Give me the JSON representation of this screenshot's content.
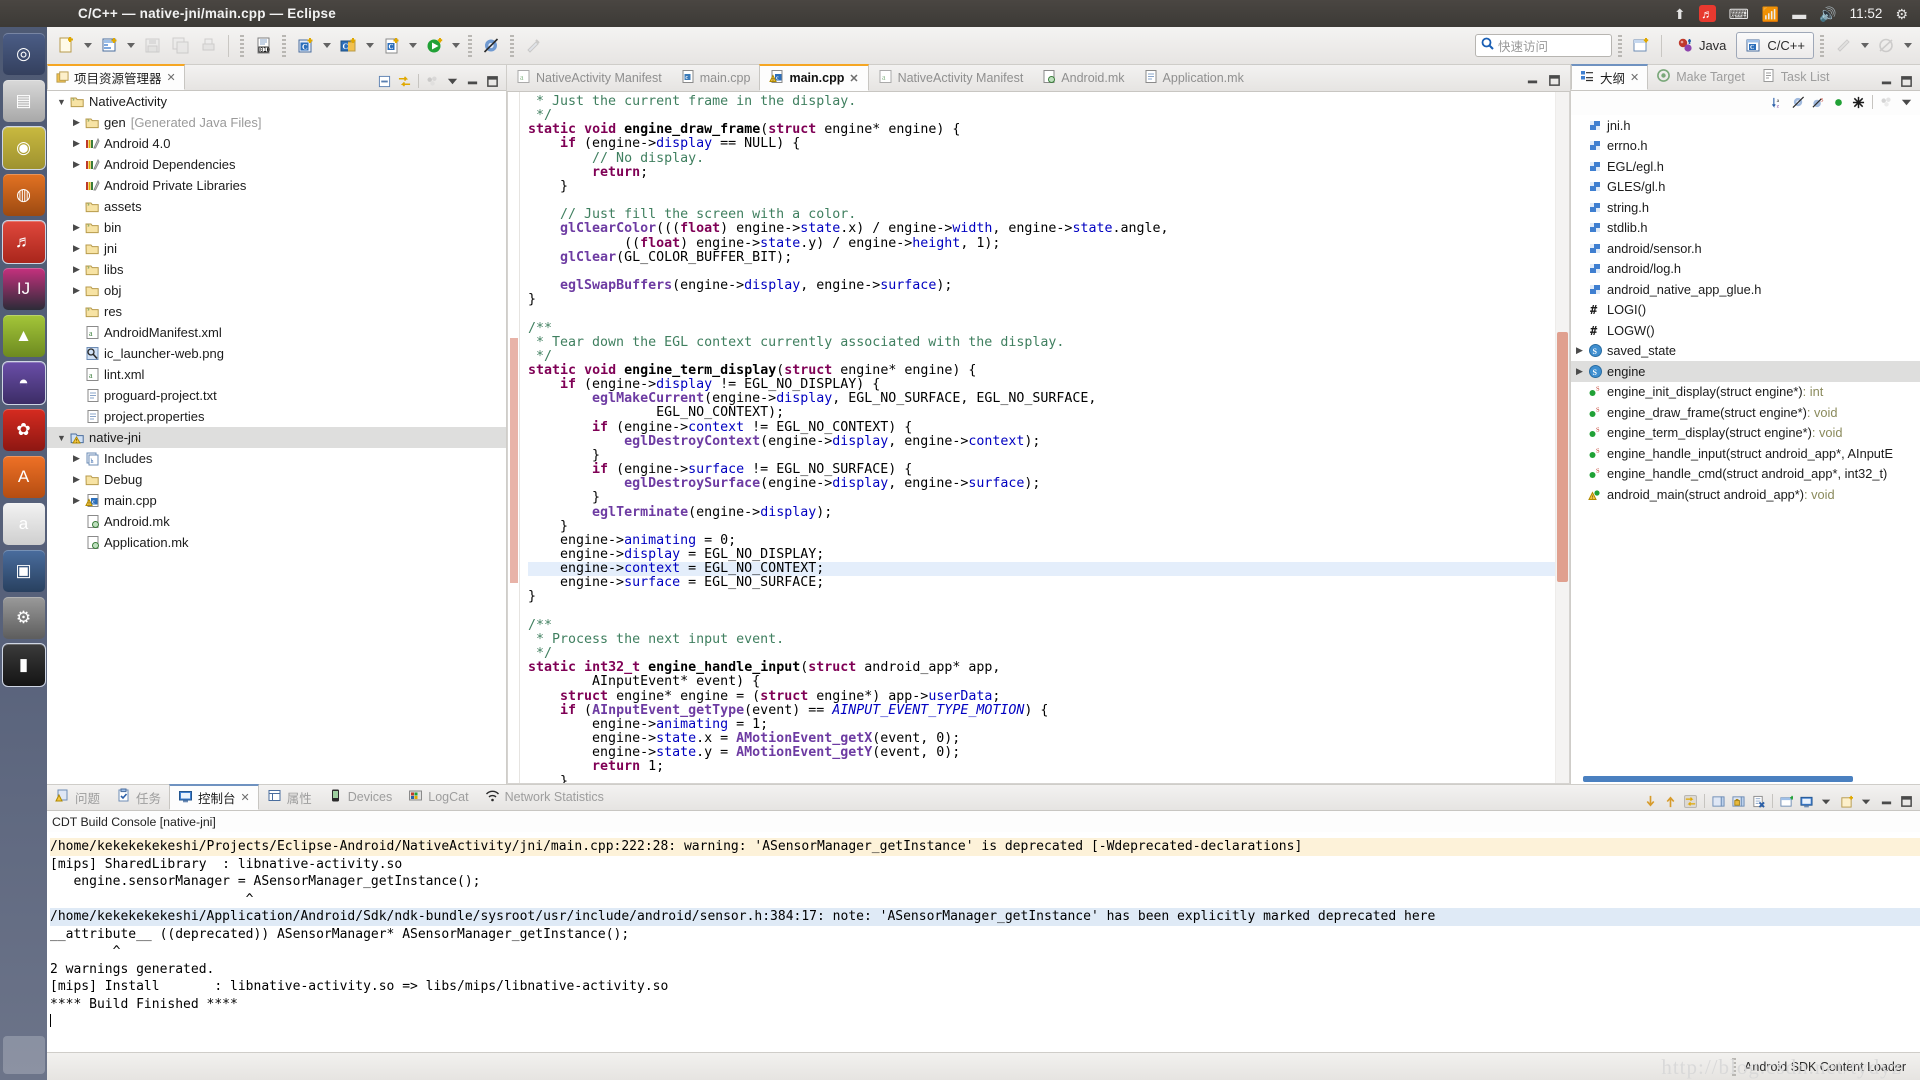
{
  "window": {
    "title": "C/C++ — native-jni/main.cpp — Eclipse"
  },
  "tray": {
    "indicator_icon": "upload-indicator-icon",
    "music_icon": "netease-music-icon",
    "keyboard_icon": "keyboard-layout-icon",
    "wifi_icon": "wifi-icon",
    "battery_icon": "battery-icon",
    "volume_icon": "volume-icon",
    "clock": "11:52",
    "session_icon": "system-settings-icon"
  },
  "launcher": {
    "items": [
      {
        "name": "ubuntu-dash-icon",
        "glyph": "◎",
        "color1": "#4b5d86",
        "color2": "#34405e",
        "selected": false
      },
      {
        "name": "files-icon",
        "glyph": "▤",
        "color1": "#d9d9d9",
        "color2": "#a8a8a8",
        "selected": false
      },
      {
        "name": "chrome-icon",
        "glyph": "◉",
        "color1": "#c9b93f",
        "color2": "#9e9230",
        "selected": true
      },
      {
        "name": "firefox-icon",
        "glyph": "◍",
        "color1": "#e37222",
        "color2": "#9c4a12",
        "selected": false
      },
      {
        "name": "netease-music-icon",
        "glyph": "♬",
        "color1": "#e0483c",
        "color2": "#a9261c",
        "selected": true
      },
      {
        "name": "intellij-idea-icon",
        "glyph": "IJ",
        "color1": "#c6307e",
        "color2": "#2c2c38",
        "selected": false
      },
      {
        "name": "android-studio-icon",
        "glyph": "▲",
        "color1": "#a4c639",
        "color2": "#6d8a20",
        "selected": false
      },
      {
        "name": "eclipse-icon",
        "glyph": "◓",
        "color1": "#6a4ea8",
        "color2": "#3c2d66",
        "selected": true
      },
      {
        "name": "redis-icon",
        "glyph": "✿",
        "color1": "#d62b20",
        "color2": "#8d1712",
        "selected": false
      },
      {
        "name": "software-center-icon",
        "glyph": "A",
        "color1": "#ef7126",
        "color2": "#b44d12",
        "selected": false
      },
      {
        "name": "amazon-icon",
        "glyph": "a",
        "color1": "#f2f2f2",
        "color2": "#cfcfcf",
        "selected": false
      },
      {
        "name": "virtualbox-icon",
        "glyph": "▣",
        "color1": "#4a6d9e",
        "color2": "#28405f",
        "selected": false
      },
      {
        "name": "system-settings-icon",
        "glyph": "⚙",
        "color1": "#9a9a9a",
        "color2": "#5d5d5d",
        "selected": false
      },
      {
        "name": "terminal-icon",
        "glyph": "▮",
        "color1": "#3b3b3b",
        "color2": "#141414",
        "selected": true
      }
    ],
    "trash_name": "trash-icon"
  },
  "toolbar": {
    "buttons": [
      {
        "name": "new-file-button",
        "caret": true
      },
      {
        "name": "new-wizard-button",
        "caret": true
      },
      {
        "name": "save-button",
        "caret": false,
        "disabled": true
      },
      {
        "name": "save-all-button",
        "caret": false,
        "disabled": true
      },
      {
        "name": "print-button",
        "caret": false,
        "disabled": true
      },
      {
        "name": "binary-file-button",
        "caret": false
      },
      {
        "name": "build-all-button",
        "caret": true
      },
      {
        "name": "open-element-button",
        "caret": true
      },
      {
        "name": "new-c-class-button",
        "caret": true
      },
      {
        "name": "run-button",
        "caret": true
      },
      {
        "name": "skip-breakpoints-button",
        "caret": false
      },
      {
        "name": "external-tools-button",
        "caret": false,
        "disabled": true
      },
      {
        "name": "search-button",
        "caret": false,
        "disabled": true
      },
      {
        "name": "debug-perspective-button",
        "caret": true,
        "disabled": true
      }
    ],
    "quick_access": {
      "icon": "search-icon",
      "placeholder": "快速访问"
    },
    "open_perspective_name": "open-perspective-button",
    "perspectives": [
      {
        "label": "Java",
        "icon": "java-perspective-icon",
        "active": false
      },
      {
        "label": "C/C++",
        "icon": "cpp-perspective-icon",
        "active": true
      }
    ]
  },
  "explorer": {
    "tab": {
      "label": "项目资源管理器",
      "close": "✕",
      "icon": "project-explorer-icon"
    },
    "tools": [
      "collapse-all-icon",
      "link-with-editor-icon",
      "view-menu-icon",
      "minimize-icon",
      "maximize-icon"
    ],
    "tree": [
      {
        "label": "NativeActivity",
        "indent": 0,
        "arrow": "open",
        "icon": "java-project-icon",
        "selected": false
      },
      {
        "label": "gen",
        "suffix": "[Generated Java Files]",
        "indent": 1,
        "arrow": "closed",
        "icon": "source-folder-icon"
      },
      {
        "label": "Android 4.0",
        "indent": 1,
        "arrow": "closed",
        "icon": "library-icon"
      },
      {
        "label": "Android Dependencies",
        "indent": 1,
        "arrow": "closed",
        "icon": "library-icon"
      },
      {
        "label": "Android Private Libraries",
        "indent": 1,
        "arrow": "none",
        "icon": "library-icon"
      },
      {
        "label": "assets",
        "indent": 1,
        "arrow": "none",
        "icon": "folder-src-icon"
      },
      {
        "label": "bin",
        "indent": 1,
        "arrow": "closed",
        "icon": "folder-src-icon"
      },
      {
        "label": "jni",
        "indent": 1,
        "arrow": "closed",
        "icon": "folder-icon"
      },
      {
        "label": "libs",
        "indent": 1,
        "arrow": "closed",
        "icon": "folder-src-icon"
      },
      {
        "label": "obj",
        "indent": 1,
        "arrow": "closed",
        "icon": "folder-icon"
      },
      {
        "label": "res",
        "indent": 1,
        "arrow": "none",
        "icon": "folder-src-icon"
      },
      {
        "label": "AndroidManifest.xml",
        "indent": 1,
        "arrow": "none",
        "icon": "android-xml-icon"
      },
      {
        "label": "ic_launcher-web.png",
        "indent": 1,
        "arrow": "none",
        "icon": "image-file-icon"
      },
      {
        "label": "lint.xml",
        "indent": 1,
        "arrow": "none",
        "icon": "android-xml-icon"
      },
      {
        "label": "proguard-project.txt",
        "indent": 1,
        "arrow": "none",
        "icon": "text-file-icon"
      },
      {
        "label": "project.properties",
        "indent": 1,
        "arrow": "none",
        "icon": "text-file-icon"
      },
      {
        "label": "native-jni",
        "indent": 0,
        "arrow": "open",
        "icon": "cpp-project-warning-icon",
        "selected": true
      },
      {
        "label": "Includes",
        "indent": 1,
        "arrow": "closed",
        "icon": "includes-icon"
      },
      {
        "label": "Debug",
        "indent": 1,
        "arrow": "closed",
        "icon": "folder-icon"
      },
      {
        "label": "main.cpp",
        "indent": 1,
        "arrow": "closed",
        "icon": "cpp-file-warning-icon"
      },
      {
        "label": "Android.mk",
        "indent": 1,
        "arrow": "none",
        "icon": "makefile-icon"
      },
      {
        "label": "Application.mk",
        "indent": 1,
        "arrow": "none",
        "icon": "makefile-icon"
      }
    ]
  },
  "editor": {
    "tabs": [
      {
        "label": "NativeActivity Manifest",
        "icon": "android-manifest-icon",
        "active": false
      },
      {
        "label": "main.cpp",
        "icon": "c-file-icon",
        "active": false
      },
      {
        "label": "main.cpp",
        "icon": "cpp-file-warning-icon",
        "active": true,
        "close": "✕"
      },
      {
        "label": "NativeActivity Manifest",
        "icon": "android-manifest-icon",
        "active": false
      },
      {
        "label": "Android.mk",
        "icon": "makefile-icon",
        "active": false
      },
      {
        "label": "Application.mk",
        "icon": "text-file-icon",
        "active": false
      }
    ],
    "minimize_name": "minimize-editor-icon",
    "maximize_name": "maximize-editor-icon",
    "code_lines": [
      " * Just the current frame in the display.",
      " */",
      "static void engine_draw_frame(struct engine* engine) {",
      "    if (engine->display == NULL) {",
      "        // No display.",
      "        return;",
      "    }",
      "",
      "    // Just fill the screen with a color.",
      "    glClearColor(((float) engine->state.x) / engine->width, engine->state.angle,",
      "            ((float) engine->state.y) / engine->height, 1);",
      "    glClear(GL_COLOR_BUFFER_BIT);",
      "",
      "    eglSwapBuffers(engine->display, engine->surface);",
      "}",
      "",
      "/**",
      " * Tear down the EGL context currently associated with the display.",
      " */",
      "static void engine_term_display(struct engine* engine) {",
      "    if (engine->display != EGL_NO_DISPLAY) {",
      "        eglMakeCurrent(engine->display, EGL_NO_SURFACE, EGL_NO_SURFACE,",
      "                EGL_NO_CONTEXT);",
      "        if (engine->context != EGL_NO_CONTEXT) {",
      "            eglDestroyContext(engine->display, engine->context);",
      "        }",
      "        if (engine->surface != EGL_NO_SURFACE) {",
      "            eglDestroySurface(engine->display, engine->surface);",
      "        }",
      "        eglTerminate(engine->display);",
      "    }",
      "    engine->animating = 0;",
      "    engine->display = EGL_NO_DISPLAY;",
      "    engine->context = EGL_NO_CONTEXT;",
      "    engine->surface = EGL_NO_SURFACE;",
      "}",
      "",
      "/**",
      " * Process the next input event.",
      " */",
      "static int32_t engine_handle_input(struct android_app* app,",
      "        AInputEvent* event) {",
      "    struct engine* engine = (struct engine*) app->userData;",
      "    if (AInputEvent_getType(event) == AINPUT_EVENT_TYPE_MOTION) {",
      "        engine->animating = 1;",
      "        engine->state.x = AMotionEvent_getX(event, 0);",
      "        engine->state.y = AMotionEvent_getY(event, 0);",
      "        return 1;",
      "    }"
    ],
    "highlighted_line_index": 33
  },
  "outline": {
    "tabs": [
      {
        "label": "大纲",
        "icon": "outline-icon",
        "active": true,
        "close": "✕"
      },
      {
        "label": "Make Target",
        "icon": "make-target-icon",
        "active": false
      },
      {
        "label": "Task List",
        "icon": "task-list-icon",
        "active": false
      }
    ],
    "tools": [
      "sort-icon",
      "hide-fields-icon",
      "hide-static-icon",
      "hide-nonpublic-icon",
      "hide-macros-icon",
      "view-menu-icon"
    ],
    "minimize_name": "minimize-outline-icon",
    "maximize_name": "maximize-outline-icon",
    "items": [
      {
        "label": "jni.h",
        "icon": "include-icon",
        "arrow": "none"
      },
      {
        "label": "errno.h",
        "icon": "include-icon",
        "arrow": "none"
      },
      {
        "label": "EGL/egl.h",
        "icon": "include-icon",
        "arrow": "none"
      },
      {
        "label": "GLES/gl.h",
        "icon": "include-icon",
        "arrow": "none"
      },
      {
        "label": "string.h",
        "icon": "include-icon",
        "arrow": "none"
      },
      {
        "label": "stdlib.h",
        "icon": "include-icon",
        "arrow": "none"
      },
      {
        "label": "android/sensor.h",
        "icon": "include-icon",
        "arrow": "none"
      },
      {
        "label": "android/log.h",
        "icon": "include-icon",
        "arrow": "none"
      },
      {
        "label": "android_native_app_glue.h",
        "icon": "include-icon",
        "arrow": "none"
      },
      {
        "label": "LOGI()",
        "icon": "macro-icon",
        "arrow": "none"
      },
      {
        "label": "LOGW()",
        "icon": "macro-icon",
        "arrow": "none"
      },
      {
        "label": "saved_state",
        "icon": "struct-icon",
        "arrow": "closed"
      },
      {
        "label": "engine",
        "icon": "struct-icon",
        "arrow": "closed",
        "selected": true
      },
      {
        "label": "engine_init_display(struct engine*)",
        "ret": " : int",
        "icon": "static-function-icon",
        "arrow": "none"
      },
      {
        "label": "engine_draw_frame(struct engine*)",
        "ret": " : void",
        "icon": "static-function-icon",
        "arrow": "none"
      },
      {
        "label": "engine_term_display(struct engine*)",
        "ret": " : void",
        "icon": "static-function-icon",
        "arrow": "none"
      },
      {
        "label": "engine_handle_input(struct android_app*, AInputE",
        "ret": "",
        "icon": "static-function-icon",
        "arrow": "none"
      },
      {
        "label": "engine_handle_cmd(struct android_app*, int32_t)",
        "ret": "",
        "icon": "static-function-icon",
        "arrow": "none"
      },
      {
        "label": "android_main(struct android_app*)",
        "ret": " : void",
        "icon": "function-warning-icon",
        "arrow": "none"
      }
    ]
  },
  "console": {
    "tabs": [
      {
        "label": "问题",
        "icon": "problems-icon",
        "active": false
      },
      {
        "label": "任务",
        "icon": "tasks-icon",
        "active": false
      },
      {
        "label": "控制台",
        "icon": "console-icon",
        "active": true,
        "close": "✕"
      },
      {
        "label": "属性",
        "icon": "properties-icon",
        "active": false
      },
      {
        "label": "Devices",
        "icon": "devices-icon",
        "active": false
      },
      {
        "label": "LogCat",
        "icon": "logcat-icon",
        "active": false
      },
      {
        "label": "Network Statistics",
        "icon": "network-statistics-icon",
        "active": false
      }
    ],
    "tools": [
      "scroll-lock-down-icon",
      "scroll-up-icon",
      "pin-console-icon",
      "save-console-icon",
      "lock-console-icon",
      "clear-console-icon",
      "open-console-icon",
      "display-console-icon",
      "display-console-menu-icon",
      "new-console-view-icon",
      "new-console-menu-icon",
      "minimize-console-icon",
      "maximize-console-icon"
    ],
    "title": "CDT Build Console [native-jni]",
    "lines": [
      {
        "text": "/home/kekekekekeshi/Projects/Eclipse-Android/NativeActivity/jni/main.cpp:222:28: warning: 'ASensorManager_getInstance' is deprecated [-Wdeprecated-declarations]",
        "style": "warn"
      },
      {
        "text": "[mips] SharedLibrary  : libnative-activity.so",
        "style": "plain"
      },
      {
        "text": "   engine.sensorManager = ASensorManager_getInstance();",
        "style": "plain"
      },
      {
        "text": "                         ^",
        "style": "plain"
      },
      {
        "text": "",
        "style": "plain"
      },
      {
        "text": "/home/kekekekekeshi/Application/Android/Sdk/ndk-bundle/sysroot/usr/include/android/sensor.h:384:17: note: 'ASensorManager_getInstance' has been explicitly marked deprecated here",
        "style": "note"
      },
      {
        "text": "__attribute__ ((deprecated)) ASensorManager* ASensorManager_getInstance();",
        "style": "plain"
      },
      {
        "text": "        ^",
        "style": "plain"
      },
      {
        "text": "",
        "style": "plain"
      },
      {
        "text": "2 warnings generated.",
        "style": "plain"
      },
      {
        "text": "[mips] Install       : libnative-activity.so => libs/mips/libnative-activity.so",
        "style": "plain"
      },
      {
        "text": "",
        "style": "plain"
      },
      {
        "text": "**** Build Finished ****",
        "style": "plain"
      }
    ]
  },
  "statusbar": {
    "job_label": "Android SDK Content Loader",
    "watermark": "http://blog.csdn.net/tydyz"
  },
  "colors": {
    "accent_orange": "#f5a623",
    "selection_blue": "#e4eefb",
    "tree_selection": "#dededd",
    "warning_bg": "#fdf2d9",
    "note_bg": "#dfeaf6",
    "changebar_pink": "#e8b3a8"
  }
}
